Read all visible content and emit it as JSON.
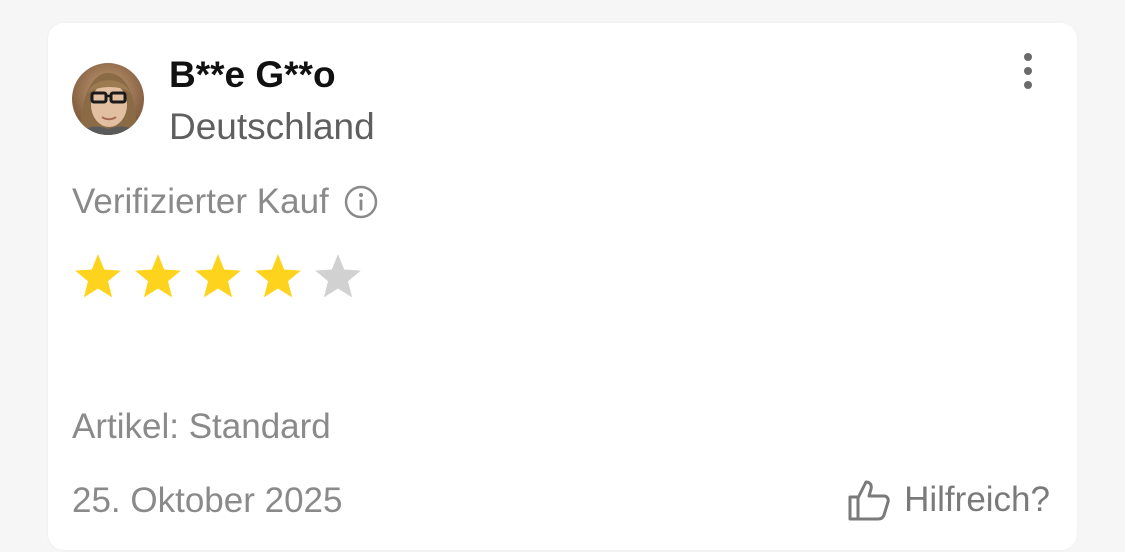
{
  "review": {
    "reviewer_name": "B**e G**o",
    "reviewer_country": "Deutschland",
    "verified_label": "Verifizierter Kauf",
    "rating": 4,
    "rating_max": 5,
    "article": "Artikel: Standard",
    "date": "25. Oktober 2025",
    "helpful_label": "Hilfreich?"
  },
  "icons": {
    "more": "more-vertical-icon",
    "info": "info-icon",
    "helpful": "thumbs-up-icon",
    "star": "star-icon"
  },
  "colors": {
    "star_filled": "#fed31e",
    "star_empty": "#d1d1d1",
    "text_primary": "#111111",
    "text_secondary": "#8a8a8a"
  }
}
